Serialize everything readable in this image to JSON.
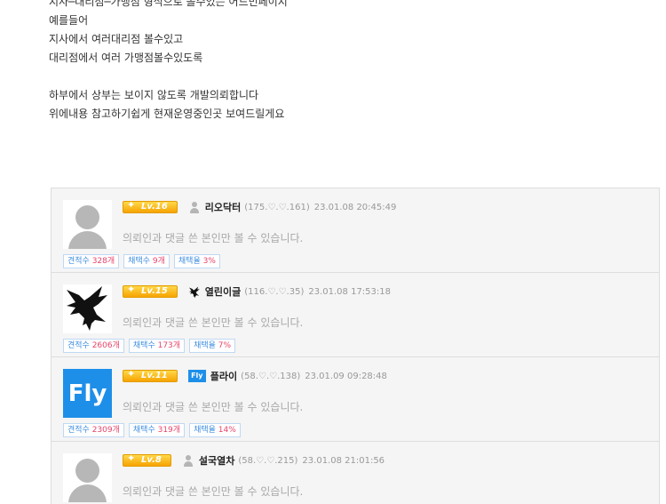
{
  "post": {
    "lines": [
      "지사─대리점─가맹점 형식으로 볼수있는 어드민페이지",
      "예를들어",
      "지사에서 여러대리점 볼수있고",
      "대리점에서 여러 가맹점볼수있도록",
      "",
      "하부에서 상부는 보이지 않도록 개발의뢰합니다",
      "위에내용 참고하기쉽게 현재운영중인곳 보여드릴게요"
    ]
  },
  "comments": [
    {
      "level": "Lv.16",
      "nick": "리오닥터",
      "ip": "(175.♡.♡.161)",
      "date": "23.01.08 20:45:49",
      "text": "의뢰인과 댓글 쓴 본인만 볼 수 있습니다.",
      "stats": {
        "quote_label": "견적수 ",
        "quote": "328개",
        "pick_label": "채택수 ",
        "pick": "9개",
        "rate_label": "채택율 ",
        "rate": "3%"
      }
    },
    {
      "level": "Lv.15",
      "nick": "열린이글",
      "ip": "(116.♡.♡.35)",
      "date": "23.01.08 17:53:18",
      "text": "의뢰인과 댓글 쓴 본인만 볼 수 있습니다.",
      "stats": {
        "quote_label": "견적수 ",
        "quote": "2606개",
        "pick_label": "채택수 ",
        "pick": "173개",
        "rate_label": "채택율 ",
        "rate": "7%"
      }
    },
    {
      "level": "Lv.11",
      "nick": "플라이",
      "ip": "(58.♡.♡.138)",
      "date": "23.01.09 09:28:48",
      "avatar_text": "Fly",
      "text": "의뢰인과 댓글 쓴 본인만 볼 수 있습니다.",
      "stats": {
        "quote_label": "견적수 ",
        "quote": "2309개",
        "pick_label": "채택수 ",
        "pick": "319개",
        "rate_label": "채택율 ",
        "rate": "14%"
      }
    },
    {
      "level": "Lv.8",
      "nick": "설국열차",
      "ip": "(58.♡.♡.215)",
      "date": "23.01.08 21:01:56",
      "text": "의뢰인과 댓글 쓴 본인만 볼 수 있습니다."
    }
  ],
  "icons": {
    "level_star": "star-icon",
    "default_avatar": "user-icon",
    "eagle_avatar": "eagle-icon",
    "fly_avatar": "fly-logo-icon"
  },
  "colors": {
    "level_badge": "#f6a400",
    "stat_number": "#e8446a",
    "stat_label": "#3e8ee0",
    "fly_brand": "#1e8fe8"
  }
}
